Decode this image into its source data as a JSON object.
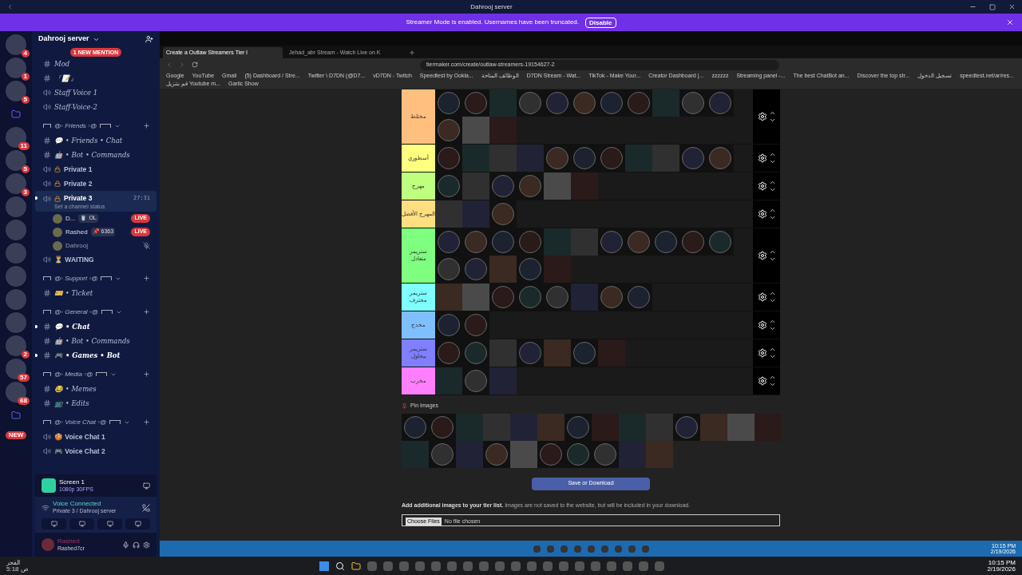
{
  "window": {
    "title": "Dahrooj server"
  },
  "banner": {
    "text": "Streamer Mode is enabled. Usernames have been truncated.",
    "button": "Disable"
  },
  "servers": [
    {
      "kind": "server",
      "badge": "4"
    },
    {
      "kind": "server",
      "badge": "1"
    },
    {
      "kind": "server",
      "badge": "5"
    },
    {
      "kind": "folder"
    },
    {
      "kind": "server",
      "badge": "11"
    },
    {
      "kind": "server",
      "badge": "5"
    },
    {
      "kind": "server",
      "badge": "3"
    },
    {
      "kind": "server"
    },
    {
      "kind": "server"
    },
    {
      "kind": "server"
    },
    {
      "kind": "server"
    },
    {
      "kind": "server"
    },
    {
      "kind": "server"
    },
    {
      "kind": "server",
      "badge": "2"
    },
    {
      "kind": "server",
      "badge": "57"
    },
    {
      "kind": "server",
      "badge": "68"
    },
    {
      "kind": "folder"
    }
  ],
  "new_badge": "NEW",
  "server_name": "Dahrooj server",
  "mention_pill": "1 NEW MENTION",
  "channels": [
    {
      "kind": "text",
      "name": "Mod",
      "unread": false
    },
    {
      "kind": "text",
      "name": "『📝』",
      "unread": false
    },
    {
      "kind": "voice",
      "name": "Staff Voice 1",
      "unread": false
    },
    {
      "kind": "voice",
      "name": "Staff-Voice-2",
      "unread": false
    },
    {
      "kind": "category",
      "name": "@◦ Friends ◦@"
    },
    {
      "kind": "text",
      "name": "💬 • Friends • Chat",
      "unread": false
    },
    {
      "kind": "text",
      "name": "🤖 • Bot • Commands",
      "unread": false
    },
    {
      "kind": "locked",
      "name": "Private 1",
      "unread": false
    },
    {
      "kind": "locked",
      "name": "Private 2",
      "unread": false
    },
    {
      "kind": "locked",
      "name": "Private 3",
      "unread": true,
      "timer": "27:31",
      "status": "Set a channel status"
    },
    {
      "kind": "user",
      "name": "D...",
      "tag": "🥤 OL",
      "live": "LIVE"
    },
    {
      "kind": "user",
      "name": "Rashed",
      "tag": "📌 6363",
      "live": "LIVE"
    },
    {
      "kind": "user",
      "name": "Dahrooj"
    },
    {
      "kind": "voice",
      "name": "⏳ WAITING",
      "unread": false
    },
    {
      "kind": "category",
      "name": "@◦ Support ◦@"
    },
    {
      "kind": "text",
      "name": "🎫 • Ticket",
      "unread": false
    },
    {
      "kind": "category",
      "name": "@◦ General ◦@"
    },
    {
      "kind": "text",
      "name": "💬 • Chat",
      "unread": true
    },
    {
      "kind": "text",
      "name": "🤖 • Bot • Commands",
      "unread": false
    },
    {
      "kind": "text",
      "name": "🎮 • Games • Bot",
      "unread": true
    },
    {
      "kind": "category",
      "name": "@◦ Media ◦@"
    },
    {
      "kind": "text",
      "name": "😂 • Memes",
      "unread": false
    },
    {
      "kind": "text",
      "name": "📺 • Edits",
      "unread": false
    },
    {
      "kind": "category",
      "name": "@◦ Voice Chat ◦@"
    },
    {
      "kind": "voice",
      "name": "🍪 Voice Chat 1",
      "unread": false
    },
    {
      "kind": "voice",
      "name": "🎮 Voice Chat 2",
      "unread": false
    }
  ],
  "stream_panel": {
    "title": "Screen 1",
    "quality": "1080p 30FPS"
  },
  "voice_panel": {
    "status": "Voice Connected",
    "channel": "Private 3 / Dahrooj server"
  },
  "user_panel": {
    "name": "Rashed",
    "tag": "Rashed7cr"
  },
  "browser": {
    "tabs": [
      {
        "label": "Create a Outlaw Streamers Tier l",
        "selected": true
      },
      {
        "label": "Jehad_abr Stream - Watch Live on K",
        "selected": false
      }
    ],
    "url": "tiermaker.com/create/outlaw-streamers-19154627-2",
    "bookmarks": [
      "Google",
      "YouTube",
      "Gmail",
      "(5) Dashboard / Stre...",
      "Twitter \\ D7DN (@D7...",
      "vD7DN - Twitch",
      "Speedtest by Ookla...",
      "الوظائف المتاحة",
      "D7DN Stream - Wat...",
      "TikTok - Make Your...",
      "Creator Dashboard |...",
      "zzzzzz",
      "Streaming panel -...",
      "The best ChatBot an...",
      "Discover the top str...",
      "تسجيل الدخول",
      "speedtest.net/ar/res...",
      "قم بتنزيل Youtube m...",
      "Garlic Show"
    ]
  },
  "tiers": [
    {
      "label": "مختلط",
      "color": "#ffbf7f",
      "images": [
        {
          "kind": "round"
        },
        {
          "kind": "round"
        },
        {
          "kind": "photo"
        },
        {
          "kind": "round"
        },
        {
          "kind": "round"
        },
        {
          "kind": "round"
        },
        {
          "kind": "round"
        },
        {
          "kind": "round"
        },
        {
          "kind": "photo"
        },
        {
          "kind": "round"
        },
        {
          "kind": "round"
        },
        {
          "kind": "round"
        },
        {
          "kind": "photo"
        },
        {
          "kind": "photo"
        }
      ]
    },
    {
      "label": "أسطوري",
      "color": "#ffff7f",
      "images": [
        {
          "kind": "round"
        },
        {
          "kind": "photo"
        },
        {
          "kind": "photo"
        },
        {
          "kind": "photo"
        },
        {
          "kind": "round"
        },
        {
          "kind": "round"
        },
        {
          "kind": "round"
        },
        {
          "kind": "photo"
        },
        {
          "kind": "photo"
        },
        {
          "kind": "round"
        },
        {
          "kind": "round"
        }
      ]
    },
    {
      "label": "مهرج",
      "color": "#bfff7f",
      "images": [
        {
          "kind": "round"
        },
        {
          "kind": "photo"
        },
        {
          "kind": "round"
        },
        {
          "kind": "round"
        },
        {
          "kind": "photo"
        },
        {
          "kind": "photo"
        }
      ]
    },
    {
      "label": "المهرج الأفضل",
      "color": "#ffdf7f",
      "images": [
        {
          "kind": "photo"
        },
        {
          "kind": "photo"
        },
        {
          "kind": "round"
        }
      ]
    },
    {
      "label": "ستريمر متعادل",
      "color": "#7fff7f",
      "images": [
        {
          "kind": "round"
        },
        {
          "kind": "round"
        },
        {
          "kind": "round"
        },
        {
          "kind": "round"
        },
        {
          "kind": "photo"
        },
        {
          "kind": "photo"
        },
        {
          "kind": "round"
        },
        {
          "kind": "round"
        },
        {
          "kind": "round"
        },
        {
          "kind": "round"
        },
        {
          "kind": "round"
        },
        {
          "kind": "round"
        },
        {
          "kind": "round"
        },
        {
          "kind": "photo"
        },
        {
          "kind": "round"
        },
        {
          "kind": "photo"
        }
      ]
    },
    {
      "label": "ستريمر محترف",
      "color": "#7fffff",
      "images": [
        {
          "kind": "photo"
        },
        {
          "kind": "photo"
        },
        {
          "kind": "round"
        },
        {
          "kind": "round"
        },
        {
          "kind": "round"
        },
        {
          "kind": "photo"
        },
        {
          "kind": "round"
        },
        {
          "kind": "round"
        }
      ]
    },
    {
      "label": "مخدج",
      "color": "#7fbfff",
      "images": [
        {
          "kind": "round"
        },
        {
          "kind": "round"
        }
      ]
    },
    {
      "label": "ستريمر بيحاول",
      "color": "#7f7fff",
      "images": [
        {
          "kind": "round"
        },
        {
          "kind": "round"
        },
        {
          "kind": "photo"
        },
        {
          "kind": "round"
        },
        {
          "kind": "photo"
        },
        {
          "kind": "round"
        },
        {
          "kind": "photo"
        }
      ]
    },
    {
      "label": "مخرب",
      "color": "#ff7fff",
      "images": [
        {
          "kind": "photo"
        },
        {
          "kind": "round"
        },
        {
          "kind": "photo"
        }
      ]
    }
  ],
  "pin": {
    "title": "Pin Images",
    "images": [
      {
        "kind": "round"
      },
      {
        "kind": "round"
      },
      {
        "kind": "photo"
      },
      {
        "kind": "photo"
      },
      {
        "kind": "photo"
      },
      {
        "kind": "photo"
      },
      {
        "kind": "round"
      },
      {
        "kind": "photo"
      },
      {
        "kind": "photo"
      },
      {
        "kind": "photo"
      },
      {
        "kind": "round"
      },
      {
        "kind": "photo"
      },
      {
        "kind": "photo"
      },
      {
        "kind": "photo"
      },
      {
        "kind": "photo"
      },
      {
        "kind": "round"
      },
      {
        "kind": "photo"
      },
      {
        "kind": "round"
      },
      {
        "kind": "photo"
      },
      {
        "kind": "round"
      },
      {
        "kind": "round"
      },
      {
        "kind": "round"
      },
      {
        "kind": "photo"
      },
      {
        "kind": "photo"
      }
    ]
  },
  "save_button": "Save or Download",
  "additional": {
    "bold": "Add additional images to your tier list.",
    "text": "Images are not saved to the website, but will be included in your download.",
    "choose": "Choose Files",
    "none": "No file chosen"
  },
  "inner_clock": {
    "time": "10:15 PM",
    "date": "2/19/2026"
  },
  "taskbar": {
    "left_1": "الفجر",
    "left_2": "5:18 ص",
    "time": "10:15 PM",
    "date": "2/19/2026"
  }
}
